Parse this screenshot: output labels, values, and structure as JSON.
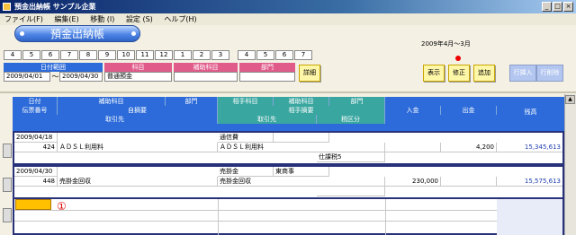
{
  "window": {
    "title": "預金出納帳 サンプル企業",
    "controls": [
      "_",
      "□",
      "×"
    ]
  },
  "menu": {
    "items": [
      "ファイル(F)",
      "編集(E)",
      "移動 (I)",
      "設定 (S)",
      "ヘルプ(H)"
    ]
  },
  "screen": {
    "title": "預金出納帳",
    "period": "2009年4月～3月"
  },
  "month_tabs": {
    "group1": [
      "4",
      "5",
      "6",
      "7",
      "8",
      "9",
      "10",
      "11",
      "12",
      "1",
      "2",
      "3"
    ],
    "group2": [
      "4",
      "5",
      "6",
      "7"
    ]
  },
  "filter": {
    "date_range_label": "日付範囲",
    "account_label": "科目",
    "sub_account_label": "補助科目",
    "department_label": "部門",
    "date_from": "2009/04/01",
    "tilde": "～",
    "date_to": "2009/04/30",
    "account_value": "普通預金",
    "sub_account_value": "",
    "department_value": "",
    "detail_button": "詳細"
  },
  "actions": {
    "show": "表示",
    "modify": "修正",
    "add": "追加",
    "insert_row": "行挿入",
    "delete_row": "行削除"
  },
  "grid": {
    "headers": {
      "date": "日付",
      "slip_no": "伝票番号",
      "sub_account": "補助科目",
      "department": "部門",
      "own_summary": "自摘要",
      "partner": "取引先",
      "opp_account": "相手科目",
      "opp_sub_account": "補助科目",
      "opp_department": "部門",
      "opp_summary": "相手摘要",
      "opp_partner": "取引先",
      "tax_category": "税区分",
      "deposit": "入金",
      "withdrawal": "出金",
      "balance": "残高"
    },
    "rows": [
      {
        "date": "2009/04/18",
        "slip_no": "424",
        "own_summary": "ＡＤＳＬ利用料",
        "opp_account": "通信費",
        "opp_sub_account": "",
        "opp_summary": "ＡＤＳＬ利用料",
        "tax_category": "仕課税5",
        "deposit": "",
        "withdrawal": "4,200",
        "balance": "15,345,613"
      },
      {
        "date": "2009/04/30",
        "slip_no": "448",
        "own_summary": "売掛金回収",
        "opp_account": "売掛金",
        "opp_sub_account": "東商事",
        "opp_summary": "売掛金回収",
        "tax_category": "",
        "deposit": "230,000",
        "withdrawal": "",
        "balance": "15,575,613"
      }
    ],
    "new_row_marker": "①"
  }
}
